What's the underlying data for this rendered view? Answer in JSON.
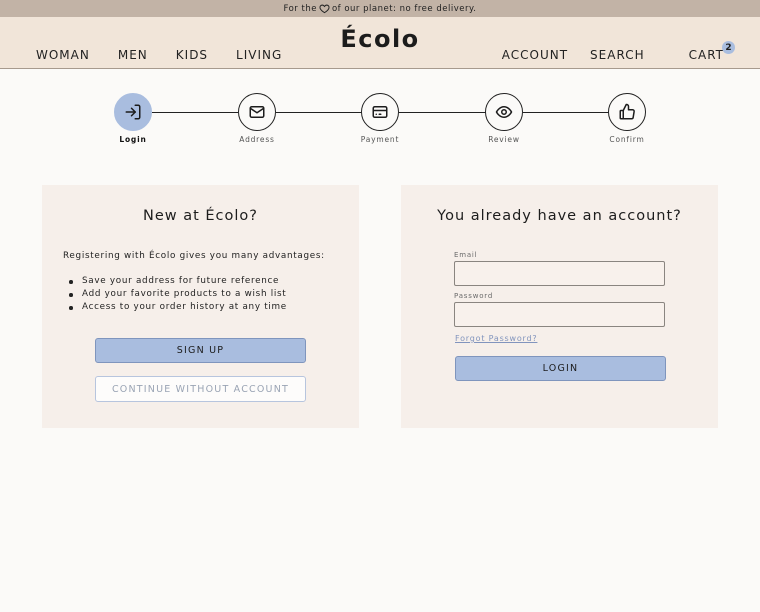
{
  "announcement": {
    "before": "For the",
    "after": "of our planet: no free delivery."
  },
  "header": {
    "logo": "Écolo",
    "nav_left": [
      "WOMAN",
      "MEN",
      "KIDS",
      "LIVING"
    ],
    "nav_right": {
      "account": "ACCOUNT",
      "search": "SEARCH",
      "cart": "CART",
      "cart_count": "2"
    }
  },
  "stepper": {
    "active_index": 0,
    "steps": [
      {
        "label": "Login",
        "icon": "login-icon"
      },
      {
        "label": "Address",
        "icon": "mail-icon"
      },
      {
        "label": "Payment",
        "icon": "credit-card-icon"
      },
      {
        "label": "Review",
        "icon": "eye-icon"
      },
      {
        "label": "Confirm",
        "icon": "thumbs-up-icon"
      }
    ]
  },
  "register": {
    "title": "New at Écolo?",
    "intro": "Registering with Écolo gives you many advantages:",
    "benefits": [
      "Save your address for future reference",
      "Add your favorite products to a wish list",
      "Access to your order history at any time"
    ],
    "signup_label": "SIGN UP",
    "continue_label": "CONTINUE WITHOUT ACCOUNT"
  },
  "login": {
    "title": "You already have an account?",
    "email_label": "Email",
    "email_value": "",
    "password_label": "Password",
    "password_value": "",
    "forgot_label": "Forgot Password?",
    "login_label": "LOGIN"
  },
  "colors": {
    "accent": "#a9bddf",
    "announcement_bg": "#c2b3a6",
    "header_bg": "#f1e5d9",
    "card_bg": "#f6efea",
    "page_bg": "#fbfaf8"
  }
}
